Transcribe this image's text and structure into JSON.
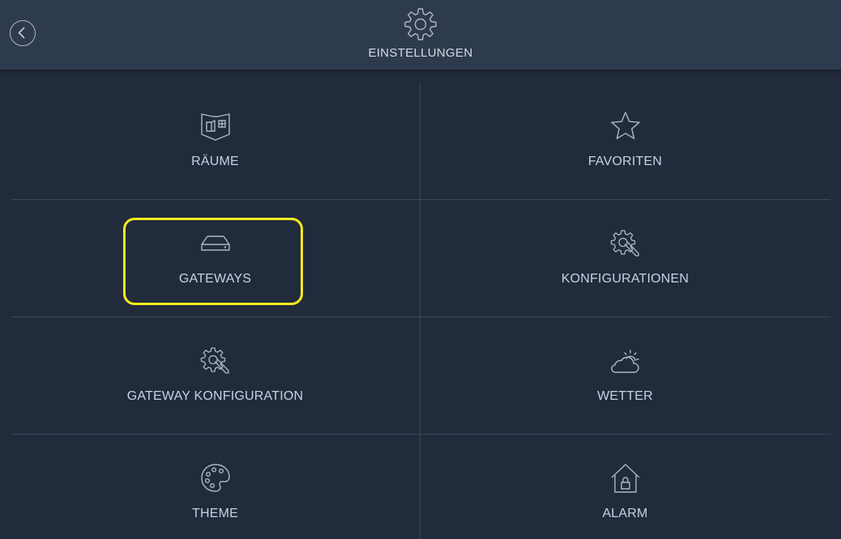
{
  "header": {
    "title": "EINSTELLUNGEN",
    "icon": "gear-icon",
    "back_icon": "chevron-left-icon"
  },
  "tiles": [
    {
      "label": "RÄUME",
      "icon": "floorplan-icon"
    },
    {
      "label": "FAVORITEN",
      "icon": "star-icon"
    },
    {
      "label": "GATEWAYS",
      "icon": "gateway-device-icon"
    },
    {
      "label": "KONFIGURATIONEN",
      "icon": "gear-wrench-icon"
    },
    {
      "label": "GATEWAY KONFIGURATION",
      "icon": "gear-wrench-icon"
    },
    {
      "label": "WETTER",
      "icon": "weather-icon"
    },
    {
      "label": "THEME",
      "icon": "palette-icon"
    },
    {
      "label": "ALARM",
      "icon": "house-lock-icon"
    }
  ],
  "colors": {
    "background": "#222b3b",
    "header_background": "#2e3a4e",
    "text": "#c6d2e4",
    "divider": "#3b4658",
    "highlight": "#f5ec1c"
  }
}
